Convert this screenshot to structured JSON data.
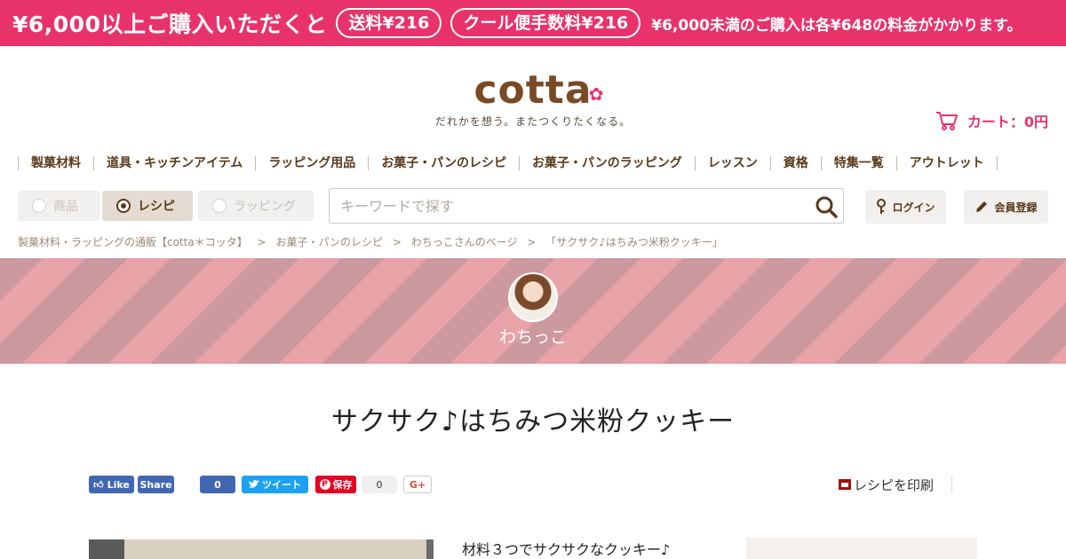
{
  "promo": {
    "lead": "¥6,000以上ご購入いただくと",
    "shipping_pill": "送料¥216",
    "cool_pill": "クール便手数料¥216",
    "tail": "¥6,000未満のご購入は各¥648の料金がかかります。"
  },
  "header": {
    "logo_text": "cotta",
    "tagline": "だれかを想う。またつくりたくなる。",
    "cart_label": "カート：0円"
  },
  "nav": {
    "items": [
      "製菓材料",
      "道具・キッチンアイテム",
      "ラッピング用品",
      "お菓子・パンのレシピ",
      "お菓子・パンのラッピング",
      "レッスン",
      "資格",
      "特集一覧",
      "アウトレット"
    ]
  },
  "search": {
    "tabs": [
      "商品",
      "レシピ",
      "ラッピング"
    ],
    "active_tab": "レシピ",
    "placeholder": "キーワードで探す",
    "login_label": "ログイン",
    "register_label": "会員登録"
  },
  "breadcrumb": {
    "items": [
      "製菓材料・ラッピングの通販【cotta＊コッタ】",
      "お菓子・パンのレシピ",
      "わちっこさんのページ",
      "「サクサク♪はちみつ米粉クッキー」"
    ],
    "separator": ">"
  },
  "author": {
    "name": "わちっこ"
  },
  "recipe": {
    "title": "サクサク♪はちみつ米粉クッキー",
    "intro": "材料３つでサクサクなクッキー♪"
  },
  "social": {
    "fb_like": "Like",
    "fb_share": "Share",
    "fb_count": "0",
    "tweet": "ツイート",
    "pin_save": "保存",
    "pin_count": "0",
    "gplus": "G+"
  },
  "print_label": "レシピを印刷",
  "colors": {
    "brand_pink": "#e8336a",
    "brand_brown": "#7a4a25",
    "stripe_dark": "#cc999e",
    "stripe_light": "#e8a3a8"
  }
}
